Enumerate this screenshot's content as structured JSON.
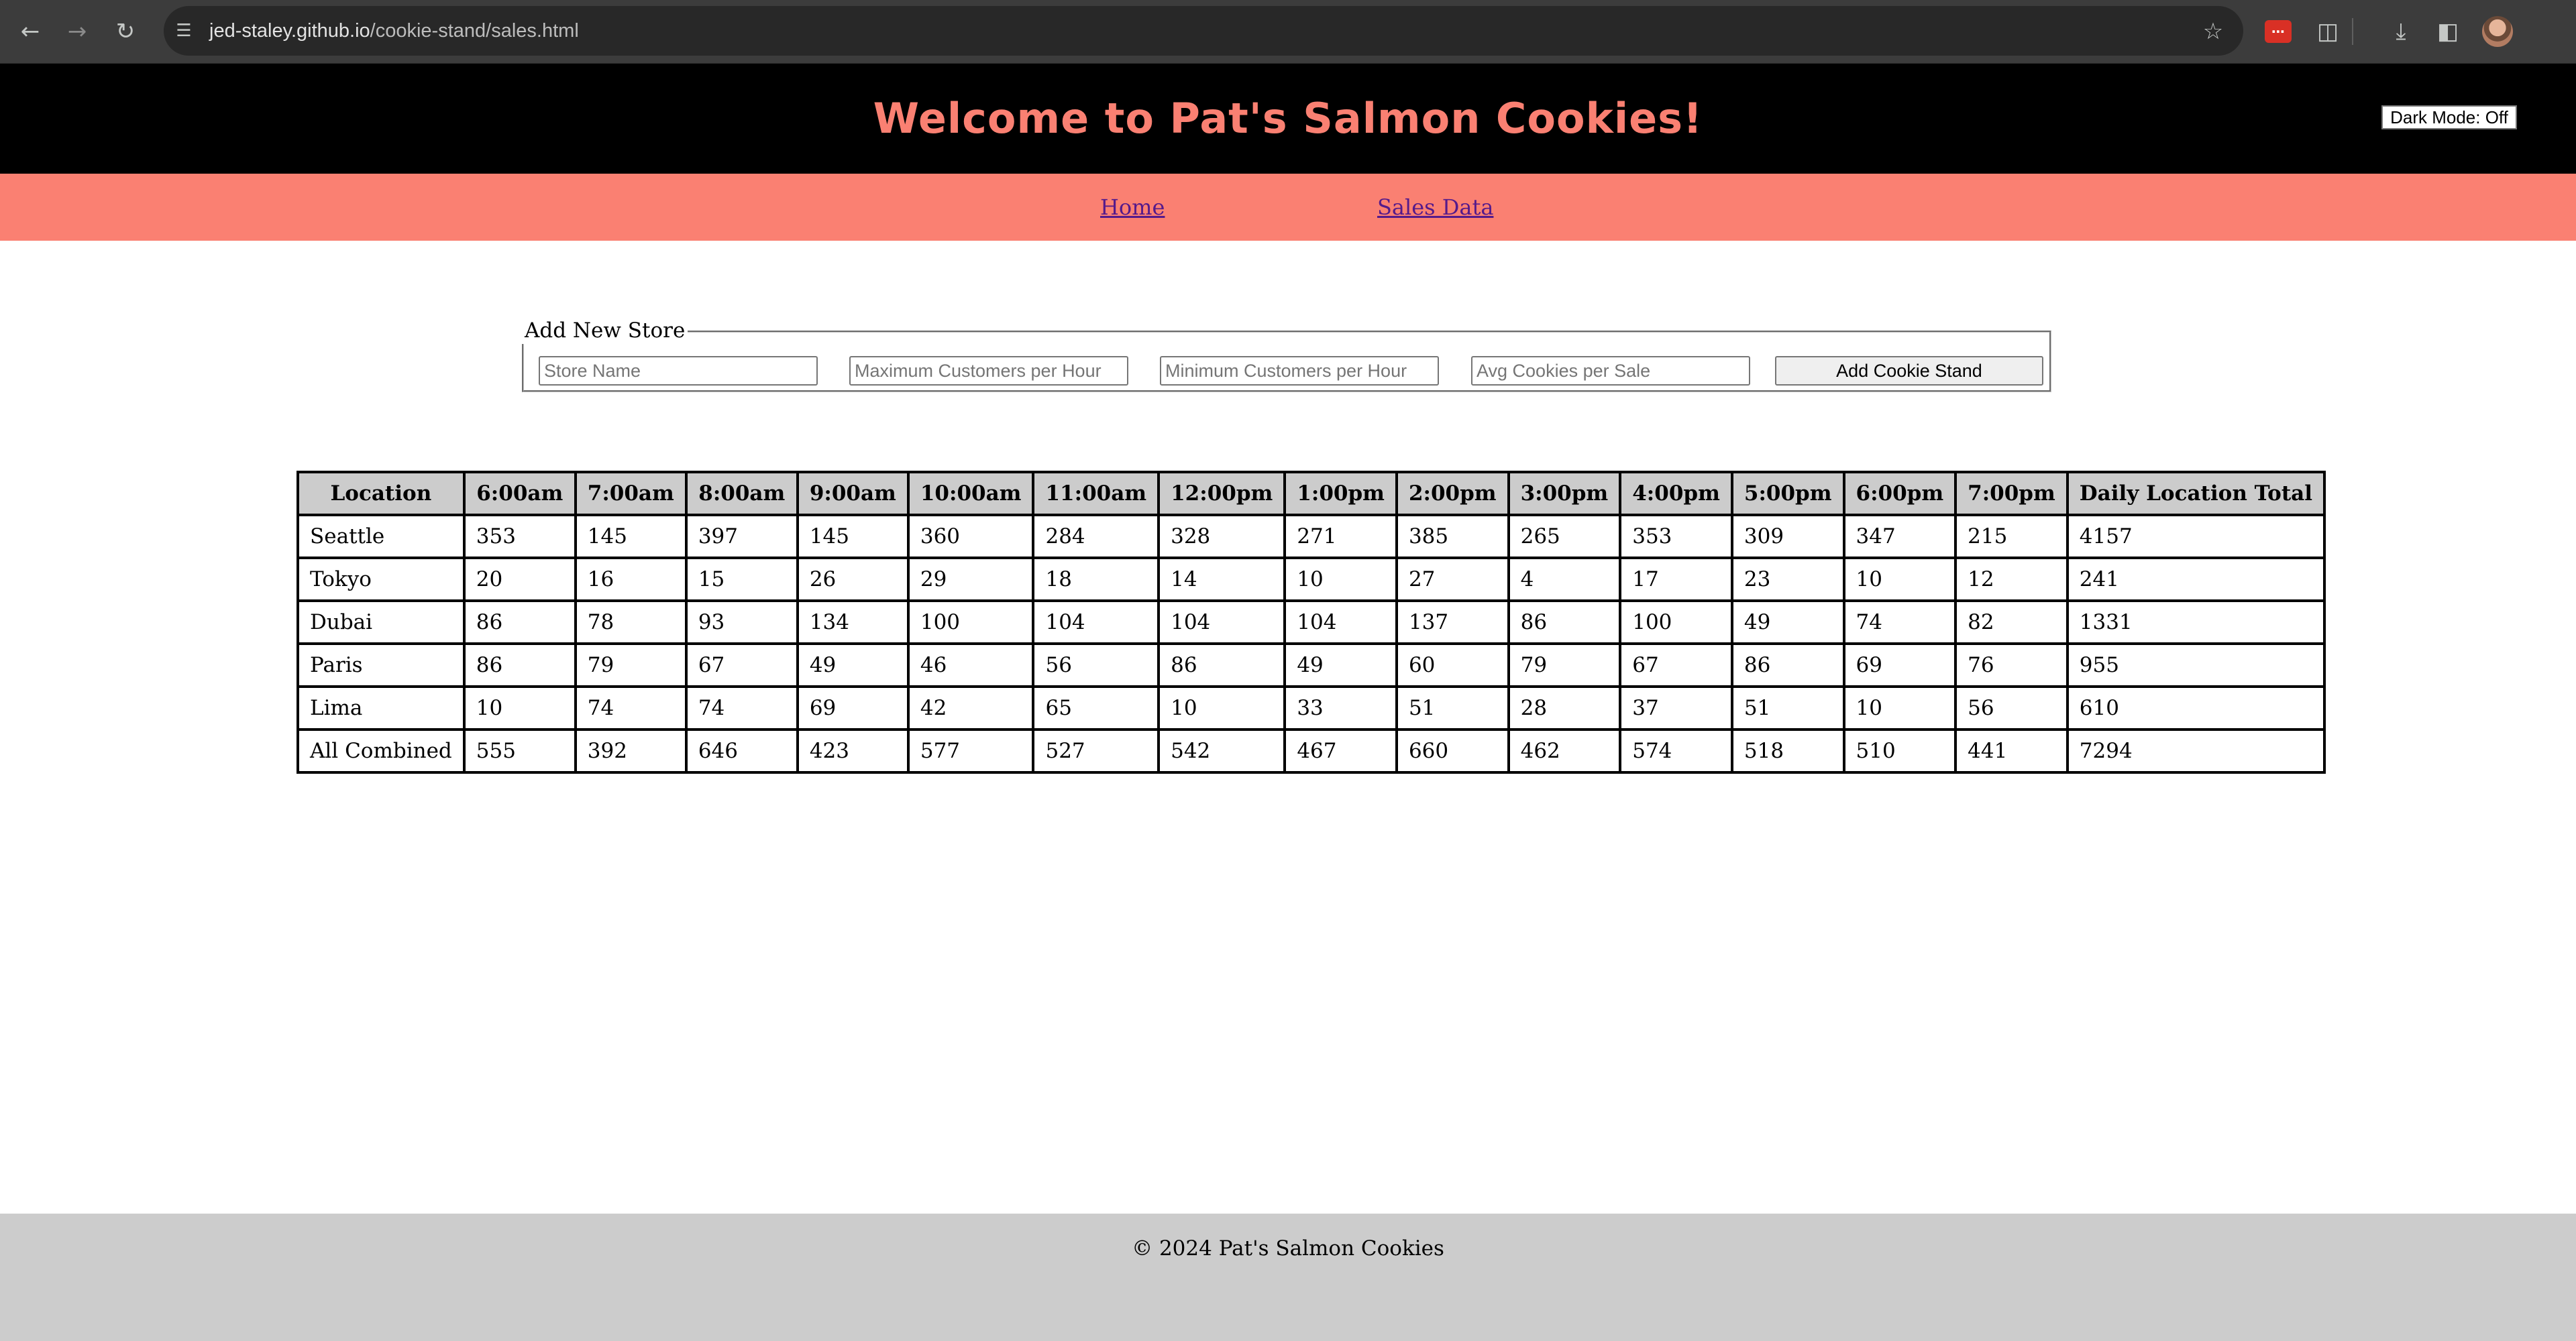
{
  "browser": {
    "url_host": "jed-staley.github.io",
    "url_path": "/cookie-stand/sales.html",
    "icons": {
      "back": "back-arrow-icon",
      "forward": "forward-arrow-icon",
      "reload": "reload-icon",
      "site_info": "tune-icon",
      "bookmark": "star-icon",
      "extension": "extension-red-icon",
      "extensions": "puzzle-icon",
      "downloads": "download-icon",
      "side_panel": "side-panel-icon",
      "profile": "avatar"
    }
  },
  "header": {
    "title": "Welcome to Pat's Salmon Cookies!",
    "dark_mode_label": "Dark Mode: Off",
    "colors": {
      "background": "#000000",
      "title": "#fa8072"
    }
  },
  "nav": {
    "links": [
      {
        "label": "Home"
      },
      {
        "label": "Sales Data"
      }
    ],
    "background": "#fa8072"
  },
  "form": {
    "legend": "Add New Store",
    "placeholders": {
      "store_name": "Store Name",
      "max_customers": "Maximum Customers per Hour",
      "min_customers": "Minimum Customers per Hour",
      "avg_cookies": "Avg Cookies per Sale"
    },
    "submit_label": "Add Cookie Stand"
  },
  "table": {
    "headers": [
      "Location",
      "6:00am",
      "7:00am",
      "8:00am",
      "9:00am",
      "10:00am",
      "11:00am",
      "12:00pm",
      "1:00pm",
      "2:00pm",
      "3:00pm",
      "4:00pm",
      "5:00pm",
      "6:00pm",
      "7:00pm",
      "Daily Location Total"
    ],
    "rows": [
      [
        "Seattle",
        "353",
        "145",
        "397",
        "145",
        "360",
        "284",
        "328",
        "271",
        "385",
        "265",
        "353",
        "309",
        "347",
        "215",
        "4157"
      ],
      [
        "Tokyo",
        "20",
        "16",
        "15",
        "26",
        "29",
        "18",
        "14",
        "10",
        "27",
        "4",
        "17",
        "23",
        "10",
        "12",
        "241"
      ],
      [
        "Dubai",
        "86",
        "78",
        "93",
        "134",
        "100",
        "104",
        "104",
        "104",
        "137",
        "86",
        "100",
        "49",
        "74",
        "82",
        "1331"
      ],
      [
        "Paris",
        "86",
        "79",
        "67",
        "49",
        "46",
        "56",
        "86",
        "49",
        "60",
        "79",
        "67",
        "86",
        "69",
        "76",
        "955"
      ],
      [
        "Lima",
        "10",
        "74",
        "74",
        "69",
        "42",
        "65",
        "10",
        "33",
        "51",
        "28",
        "37",
        "51",
        "10",
        "56",
        "610"
      ],
      [
        "All Combined",
        "555",
        "392",
        "646",
        "423",
        "577",
        "527",
        "542",
        "467",
        "660",
        "462",
        "574",
        "518",
        "510",
        "441",
        "7294"
      ]
    ],
    "header_background": "#cccccc"
  },
  "footer": {
    "text": "© 2024 Pat's Salmon Cookies",
    "background": "#cccccc"
  }
}
